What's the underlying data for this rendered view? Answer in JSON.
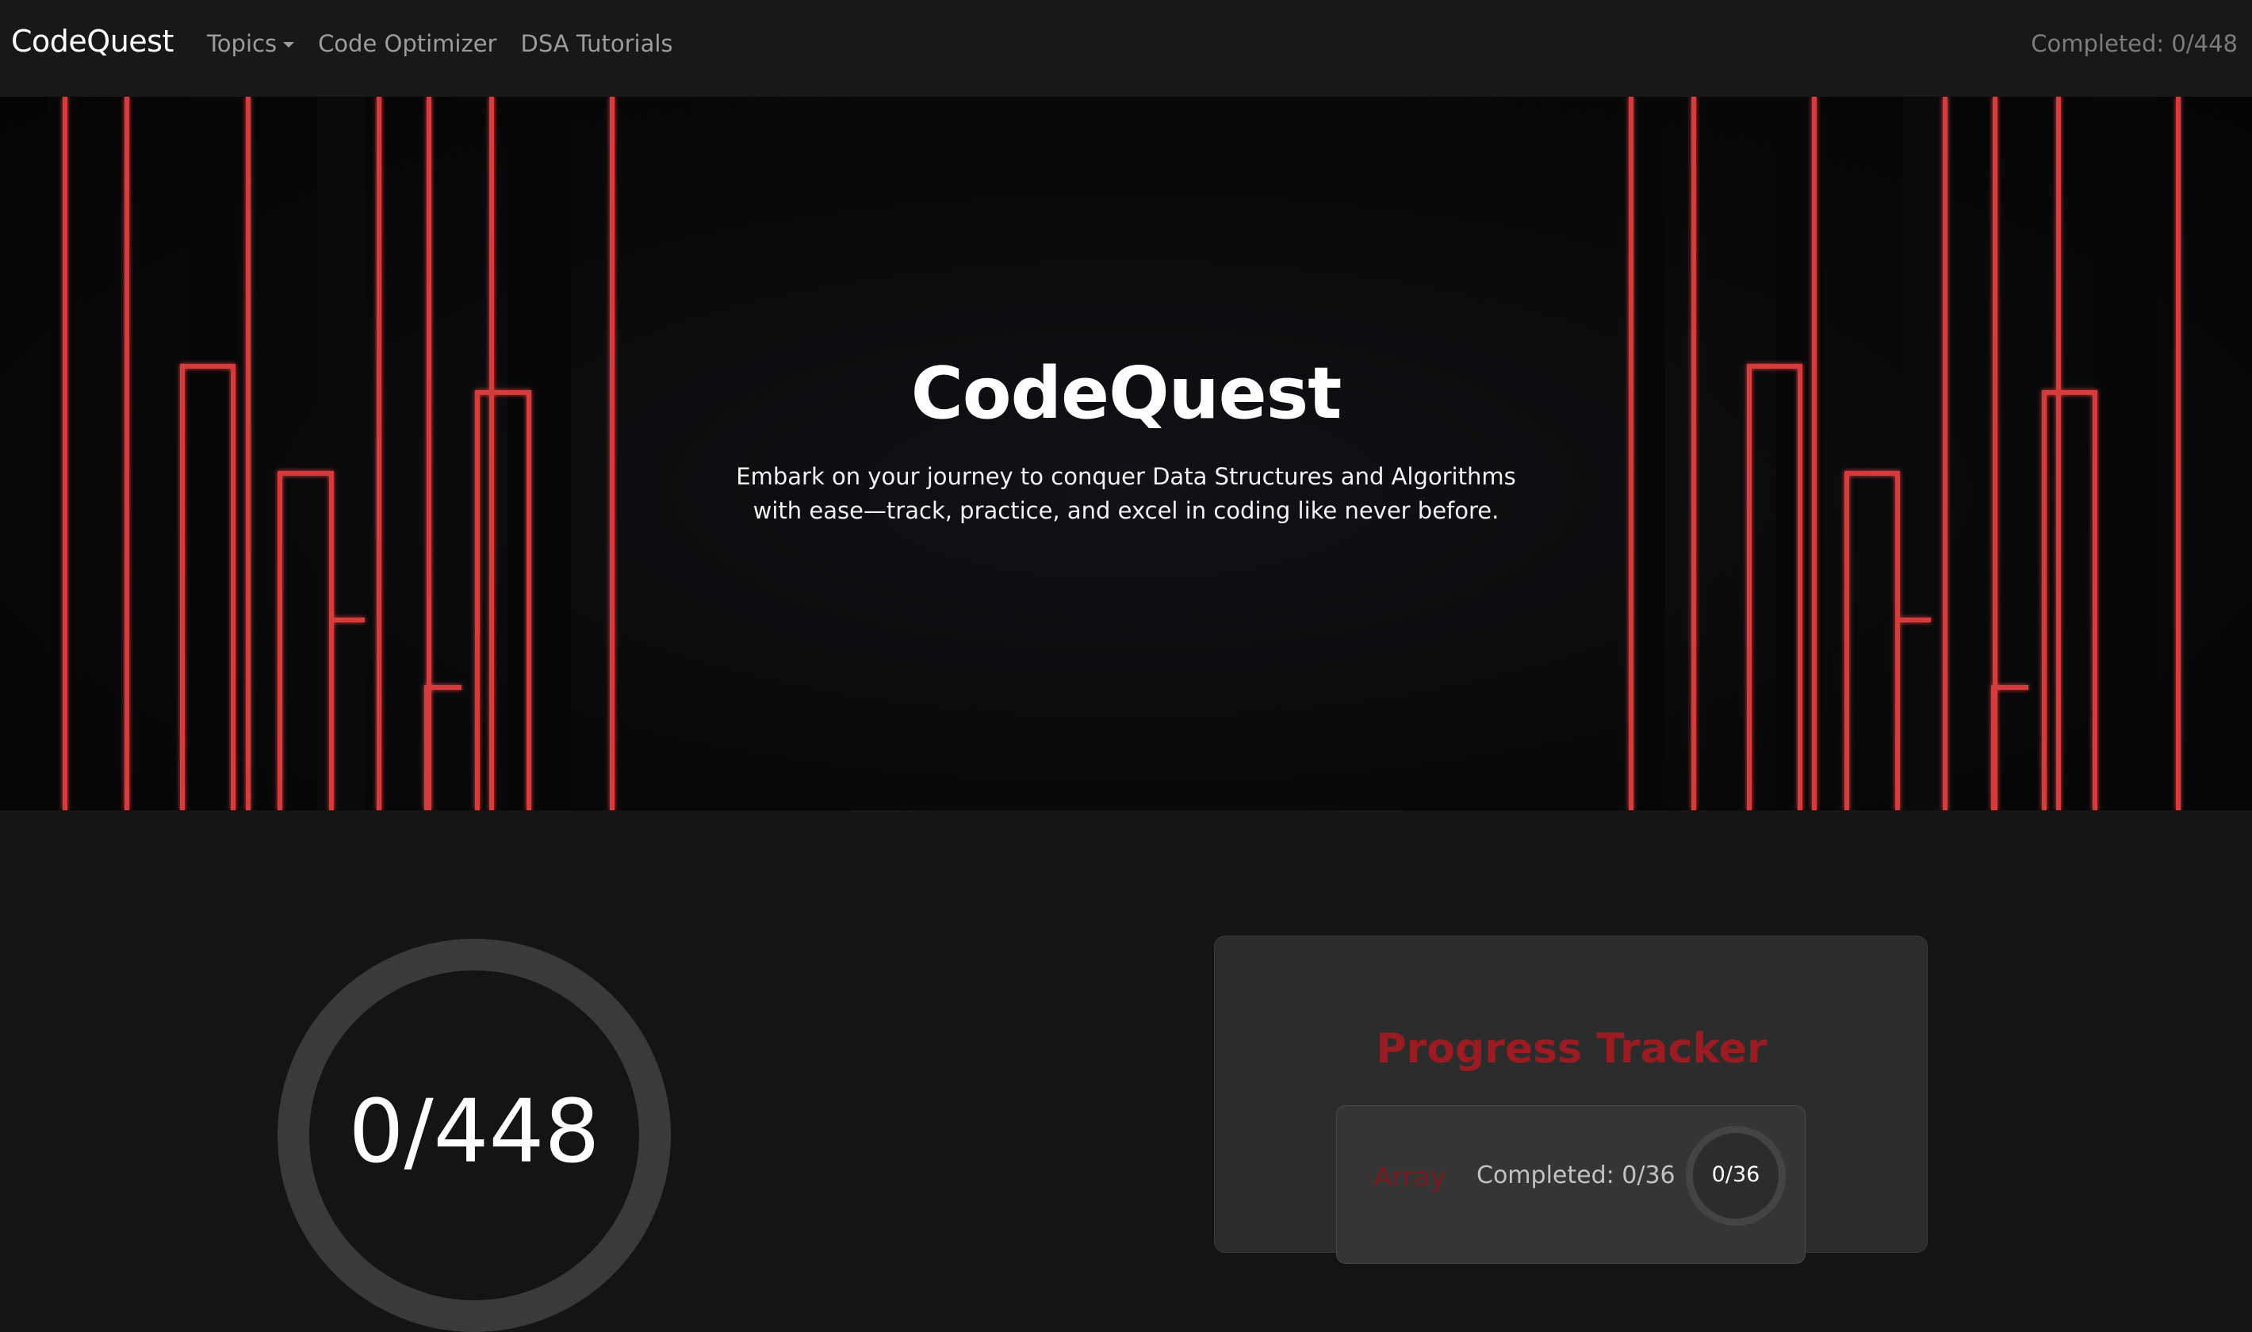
{
  "navbar": {
    "brand": "CodeQuest",
    "links": [
      {
        "label": "Topics",
        "has_dropdown": true
      },
      {
        "label": "Code Optimizer"
      },
      {
        "label": "DSA Tutorials"
      }
    ],
    "completed": "Completed: 0/448"
  },
  "hero": {
    "title": "CodeQuest",
    "subtitle_line1": "Embark on your journey to conquer Data Structures and Algorithms",
    "subtitle_line2": "with ease—track, practice, and excel in coding like never before."
  },
  "overall_progress": {
    "label": "0/448",
    "completed": 0,
    "total": 448
  },
  "tracker": {
    "title": "Progress Tracker",
    "topics": [
      {
        "name": "Array",
        "completed_text": "Completed: 0/36",
        "ring_label": "0/36",
        "completed": 0,
        "total": 36
      }
    ]
  },
  "colors": {
    "accent_red": "#9a1c22",
    "neon_red": "#e23a3a",
    "background": "#141414",
    "navbar": "#181818",
    "card": "#2c2c2c"
  },
  "icons": {
    "topics_dropdown": "caret-down-icon"
  }
}
